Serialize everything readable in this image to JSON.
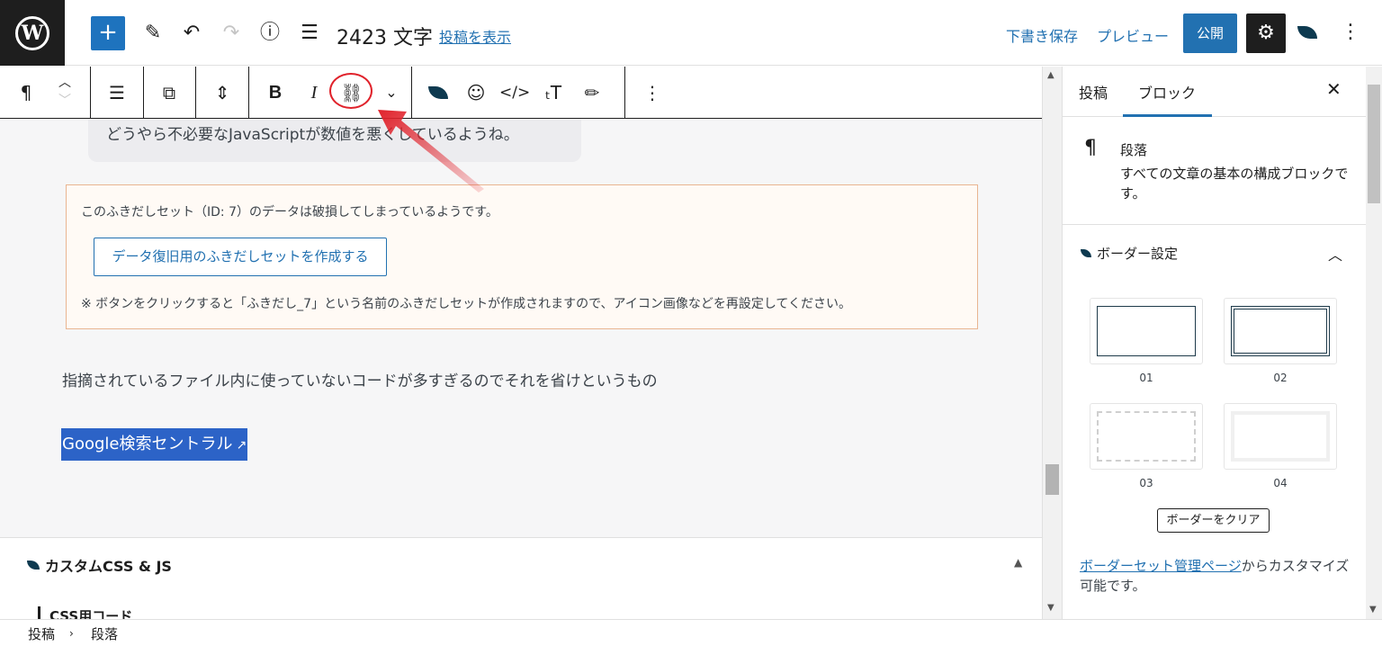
{
  "header": {
    "title": "2423 文字",
    "view_post": "投稿を表示",
    "save_draft": "下書き保存",
    "preview": "プレビュー",
    "publish": "公開"
  },
  "toolbar": {
    "items": [
      "paragraph-icon",
      "move-up-down",
      "align-left-icon",
      "duplicate-icon",
      "spacing-icon",
      "bold",
      "italic",
      "link-icon",
      "more-icon",
      "leaf-icon",
      "emoji-icon",
      "code-icon",
      "text-size-icon",
      "highlight-icon",
      "options-icon"
    ],
    "bold": "B",
    "italic": "I"
  },
  "content": {
    "bubble_text": "どうやら不必要なJavaScriptが数値を悪くしているようね。",
    "alert_message": "このふきだしセット（ID: 7）のデータは破損してしまっているようです。",
    "alert_button": "データ復旧用のふきだしセットを作成する",
    "alert_note": "※ ボタンをクリックすると「ふきだし_7」という名前のふきだしセットが作成されますので、アイコン画像などを再設定してください。",
    "paragraph": "指摘されているファイル内に使っていないコードが多すぎるのでそれを省けというもの",
    "selected_link": "Google検索セントラル"
  },
  "meta_box": {
    "title": "カスタムCSS & JS",
    "css_label": "CSS用コード"
  },
  "breadcrumb": {
    "items": [
      "投稿",
      "段落"
    ]
  },
  "sidebar": {
    "tabs": [
      "投稿",
      "ブロック"
    ],
    "active_tab": "ブロック",
    "block_title": "段落",
    "block_desc": "すべての文章の基本の構成ブロックです。",
    "panel_title": "ボーダー設定",
    "swatches": [
      "01",
      "02",
      "03",
      "04"
    ],
    "clear_button": "ボーダーをクリア",
    "help_link": "ボーダーセット管理ページ",
    "help_text": "からカスタマイズ可能です。"
  },
  "colors": {
    "accent": "#2271b1",
    "annotation": "#e0222b",
    "selection": "#2c63c7",
    "alert_border": "#e9b591"
  }
}
